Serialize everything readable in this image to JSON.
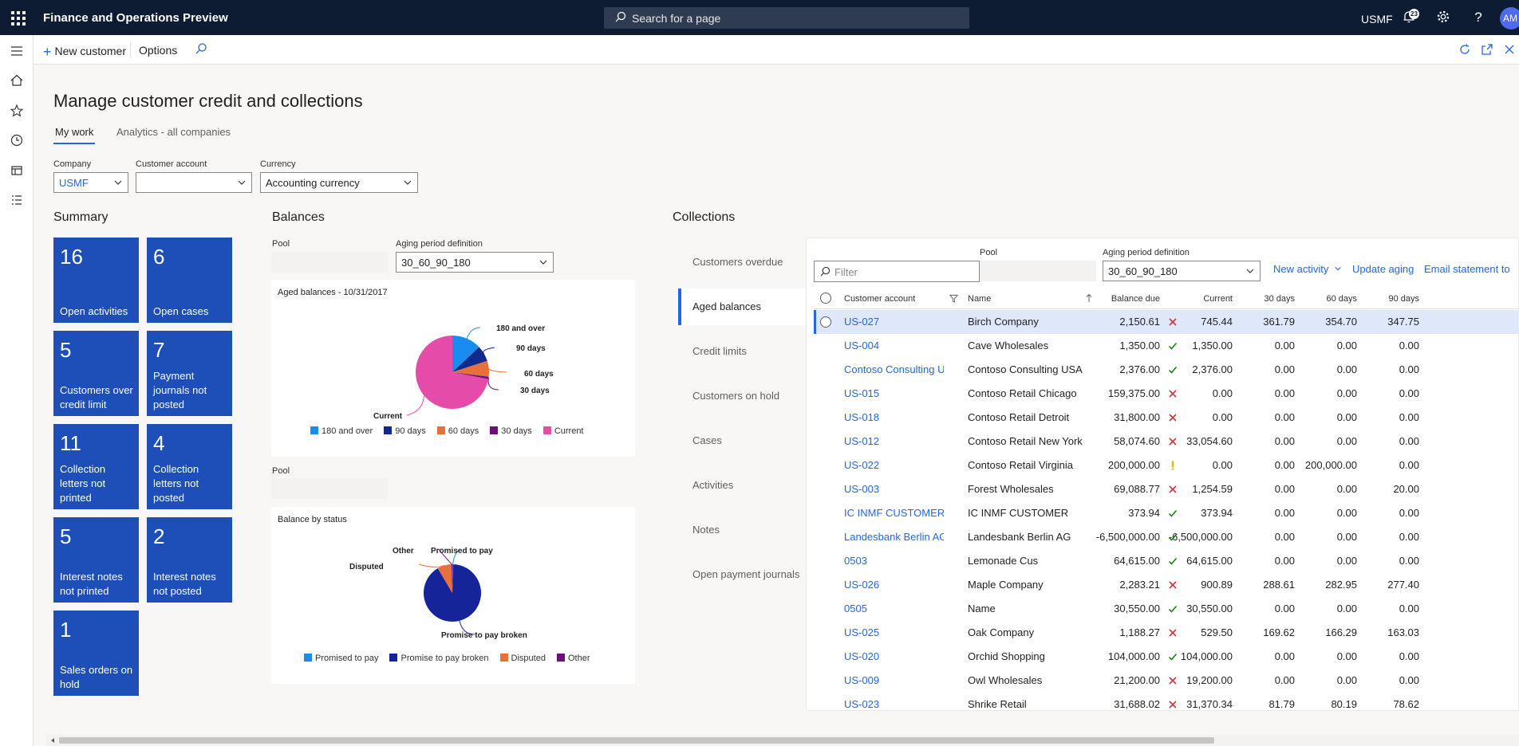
{
  "topbar": {
    "app_title": "Finance and Operations Preview",
    "search_placeholder": "Search for a page",
    "company": "USMF",
    "notification_count": "23",
    "avatar_initials": "AM"
  },
  "actionbar": {
    "new_customer": "New customer",
    "options": "Options"
  },
  "page": {
    "title": "Manage customer credit and collections",
    "tabs": [
      "My work",
      "Analytics - all companies"
    ]
  },
  "filters": {
    "company_label": "Company",
    "company_value": "USMF",
    "customer_account_label": "Customer account",
    "customer_account_value": "",
    "currency_label": "Currency",
    "currency_value": "Accounting currency"
  },
  "summary": {
    "heading": "Summary",
    "tiles": [
      {
        "num": "16",
        "label": "Open activities"
      },
      {
        "num": "6",
        "label": "Open cases"
      },
      {
        "num": "5",
        "label": "Customers over credit limit"
      },
      {
        "num": "7",
        "label": "Payment journals not posted"
      },
      {
        "num": "11",
        "label": "Collection letters not printed"
      },
      {
        "num": "4",
        "label": "Collection letters not posted"
      },
      {
        "num": "5",
        "label": "Interest notes not printed"
      },
      {
        "num": "2",
        "label": "Interest notes not posted"
      },
      {
        "num": "1",
        "label": "Sales orders on hold"
      }
    ]
  },
  "balances": {
    "heading": "Balances",
    "pool_label": "Pool",
    "aging_label": "Aging period definition",
    "aging_value": "30_60_90_180",
    "pool2_label": "Pool",
    "aged_chart_title": "Aged balances - 10/31/2017",
    "status_chart_title": "Balance by status"
  },
  "chart_data": [
    {
      "type": "pie",
      "title": "Aged balances - 10/31/2017",
      "categories": [
        "180 and over",
        "90 days",
        "60 days",
        "30 days",
        "Current"
      ],
      "values": [
        13,
        7,
        7,
        1,
        72
      ],
      "colors": [
        "#1a8cf0",
        "#0f2a8c",
        "#e8703a",
        "#6b0f7a",
        "#e54ba8"
      ],
      "legend": "bottom"
    },
    {
      "type": "pie",
      "title": "Balance by status",
      "categories": [
        "Promised to pay",
        "Promise to pay broken",
        "Disputed",
        "Other"
      ],
      "values": [
        0.5,
        91,
        8,
        0.5
      ],
      "colors": [
        "#1a8cf0",
        "#16249a",
        "#e8703a",
        "#6b0f7a"
      ],
      "legend": "bottom"
    }
  ],
  "collections": {
    "heading": "Collections",
    "nav": [
      "Customers overdue",
      "Aged balances",
      "Credit limits",
      "Customers on hold",
      "Cases",
      "Activities",
      "Notes",
      "Open payment journals"
    ],
    "active_nav": "Aged balances",
    "filter_placeholder": "Filter",
    "pool_label": "Pool",
    "aging_label": "Aging period definition",
    "aging_value": "30_60_90_180",
    "new_activity": "New activity",
    "update_aging": "Update aging",
    "email_statement": "Email statement to",
    "columns": [
      "Customer account",
      "Name",
      "Balance due",
      "Current",
      "30 days",
      "60 days",
      "90 days"
    ],
    "rows": [
      {
        "account": "US-027",
        "name": "Birch Company",
        "balance": "2,150.61",
        "status": "x",
        "current": "745.44",
        "d30": "361.79",
        "d60": "354.70",
        "d90": "347.75"
      },
      {
        "account": "US-004",
        "name": "Cave Wholesales",
        "balance": "1,350.00",
        "status": "check",
        "current": "1,350.00",
        "d30": "0.00",
        "d60": "0.00",
        "d90": "0.00"
      },
      {
        "account": "Contoso Consulting U",
        "name": "Contoso Consulting USA",
        "balance": "2,376.00",
        "status": "check",
        "current": "2,376.00",
        "d30": "0.00",
        "d60": "0.00",
        "d90": "0.00"
      },
      {
        "account": "US-015",
        "name": "Contoso Retail Chicago",
        "balance": "159,375.00",
        "status": "x",
        "current": "0.00",
        "d30": "0.00",
        "d60": "0.00",
        "d90": "0.00"
      },
      {
        "account": "US-018",
        "name": "Contoso Retail Detroit",
        "balance": "31,800.00",
        "status": "x",
        "current": "0.00",
        "d30": "0.00",
        "d60": "0.00",
        "d90": "0.00"
      },
      {
        "account": "US-012",
        "name": "Contoso Retail New York",
        "balance": "58,074.60",
        "status": "x",
        "current": "33,054.60",
        "d30": "0.00",
        "d60": "0.00",
        "d90": "0.00"
      },
      {
        "account": "US-022",
        "name": "Contoso Retail Virginia",
        "balance": "200,000.00",
        "status": "warn",
        "current": "0.00",
        "d30": "0.00",
        "d60": "200,000.00",
        "d90": "0.00"
      },
      {
        "account": "US-003",
        "name": "Forest Wholesales",
        "balance": "69,088.77",
        "status": "x",
        "current": "1,254.59",
        "d30": "0.00",
        "d60": "0.00",
        "d90": "20.00"
      },
      {
        "account": "IC INMF CUSTOMER",
        "name": "IC INMF CUSTOMER",
        "balance": "373.94",
        "status": "check",
        "current": "373.94",
        "d30": "0.00",
        "d60": "0.00",
        "d90": "0.00"
      },
      {
        "account": "Landesbank Berlin AG",
        "name": "Landesbank Berlin AG",
        "balance": "-6,500,000.00",
        "status": "check",
        "current": "-6,500,000.00",
        "d30": "0.00",
        "d60": "0.00",
        "d90": "0.00"
      },
      {
        "account": "0503",
        "name": "Lemonade Cus",
        "balance": "64,615.00",
        "status": "check",
        "current": "64,615.00",
        "d30": "0.00",
        "d60": "0.00",
        "d90": "0.00"
      },
      {
        "account": "US-026",
        "name": "Maple Company",
        "balance": "2,283.21",
        "status": "x",
        "current": "900.89",
        "d30": "288.61",
        "d60": "282.95",
        "d90": "277.40"
      },
      {
        "account": "0505",
        "name": "Name",
        "balance": "30,550.00",
        "status": "check",
        "current": "30,550.00",
        "d30": "0.00",
        "d60": "0.00",
        "d90": "0.00"
      },
      {
        "account": "US-025",
        "name": "Oak Company",
        "balance": "1,188.27",
        "status": "x",
        "current": "529.50",
        "d30": "169.62",
        "d60": "166.29",
        "d90": "163.03"
      },
      {
        "account": "US-020",
        "name": "Orchid Shopping",
        "balance": "104,000.00",
        "status": "check",
        "current": "104,000.00",
        "d30": "0.00",
        "d60": "0.00",
        "d90": "0.00"
      },
      {
        "account": "US-009",
        "name": "Owl Wholesales",
        "balance": "21,200.00",
        "status": "x",
        "current": "19,200.00",
        "d30": "0.00",
        "d60": "0.00",
        "d90": "0.00"
      },
      {
        "account": "US-023",
        "name": "Shrike Retail",
        "balance": "31,688.02",
        "status": "x",
        "current": "31,370.34",
        "d30": "81.79",
        "d60": "80.19",
        "d90": "78.62"
      }
    ]
  }
}
